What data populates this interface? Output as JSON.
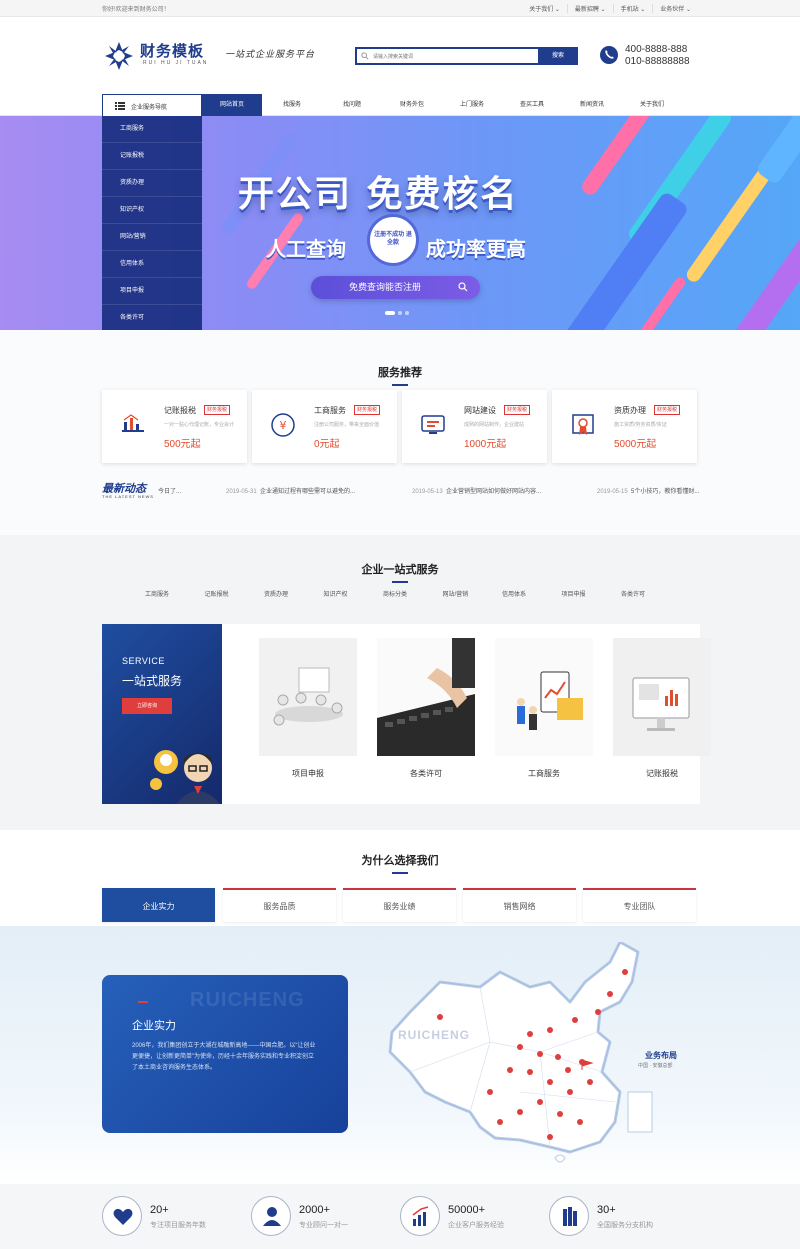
{
  "topbar": {
    "welcome": "你好!欢迎来到财务公司！",
    "links": [
      "关于我们 ⌄",
      "最新招聘 ⌄",
      "手机站 ⌄",
      "业务伙伴 ⌄"
    ]
  },
  "header": {
    "logo_name": "财务模板",
    "logo_pinyin": "RUI HU JI TUAN",
    "slogan": "一站式企业服务平台",
    "search_placeholder": "请输入搜索关键词",
    "search_button": "搜索",
    "phone1": "400-8888-888",
    "phone2": "010-88888888"
  },
  "nav": {
    "category_label": "企业服务导航",
    "links": [
      "网站首页",
      "找服务",
      "找问题",
      "财务外包",
      "上门服务",
      "查买工具",
      "新闻资讯",
      "关于我们"
    ],
    "active_index": 0
  },
  "banner": {
    "menu": [
      "工商服务",
      "记账报税",
      "资质办理",
      "知识产权",
      "网站/营销",
      "信用体系",
      "项目申报",
      "各类许可"
    ],
    "title": "开公司 免费核名",
    "sub_left": "人工查询",
    "sub_right": "成功率更高",
    "seal": "注册不成功 退全款",
    "button": "免费查询能否注册"
  },
  "recommend": {
    "title": "服务推荐",
    "cards": [
      {
        "name": "记账报税",
        "tag": "财务报税",
        "desc": "一对一贴心代理记账，专业会计",
        "price": "500元起",
        "icon": "chart-icon"
      },
      {
        "name": "工商服务",
        "tag": "财务报税",
        "desc": "注册公司服务，带来全面价值",
        "price": "0元起",
        "icon": "yuan-icon"
      },
      {
        "name": "网站建设",
        "tag": "财务报税",
        "desc": "成熟的网站制作，企业建站",
        "price": "1000元起",
        "icon": "monitor-icon"
      },
      {
        "name": "资质办理",
        "tag": "财务报税",
        "desc": "施工资质/劳务资质/资证",
        "price": "5000元起",
        "icon": "certificate-icon"
      }
    ]
  },
  "news": {
    "logo": "最新动态",
    "logo_en": "THE LATEST NEWS",
    "items": [
      {
        "date": "",
        "title": "今日了..."
      },
      {
        "date": "2019-05-31",
        "title": "企业通知过程有哪些需可以避免的..."
      },
      {
        "date": "2019-05-13",
        "title": "企业营销型网站如何做好网站内容..."
      },
      {
        "date": "2019-05-15",
        "title": "5个小技巧，教你看懂财..."
      }
    ]
  },
  "onestop": {
    "title": "企业一站式服务",
    "tabs": [
      "工商服务",
      "记账报税",
      "资质办理",
      "知识产权",
      "商标分类",
      "网站/营销",
      "信用体系",
      "项目申报",
      "各类许可"
    ],
    "side_en": "SERVICE",
    "side_cn": "一站式服务",
    "side_button": "立即咨询",
    "items": [
      "项目申报",
      "各类许可",
      "工商服务",
      "记账报税"
    ]
  },
  "why": {
    "title": "为什么选择我们",
    "tabs": [
      "企业实力",
      "服务品质",
      "服务业绩",
      "销售网络",
      "专业团队"
    ],
    "active_index": 0,
    "watermark": "RUICHENG",
    "heading": "企业实力",
    "paragraph": "2006年，我们集团创立于大湖在城融新高地——中国合肥。以“让创业更便捷，让创新更简单”为使命，历经十余年服务实践和专业积淀创立了本土商业咨询服务生态体系。",
    "map_watermark": "RUICHENG",
    "map_title": "业务布局",
    "map_sub": "中国 · 安徽总部"
  },
  "stats": [
    {
      "num": "20+",
      "txt": "专注项目服务年数",
      "icon": "heart-icon"
    },
    {
      "num": "2000+",
      "txt": "专业顾问一对一",
      "icon": "person-icon"
    },
    {
      "num": "50000+",
      "txt": "企业客户服务经验",
      "icon": "growth-icon"
    },
    {
      "num": "30+",
      "txt": "全国服务分支机构",
      "icon": "building-icon"
    }
  ],
  "colors": {
    "brand": "#1f3d8c",
    "accent": "#e03d3d",
    "price": "#e24c2f"
  }
}
